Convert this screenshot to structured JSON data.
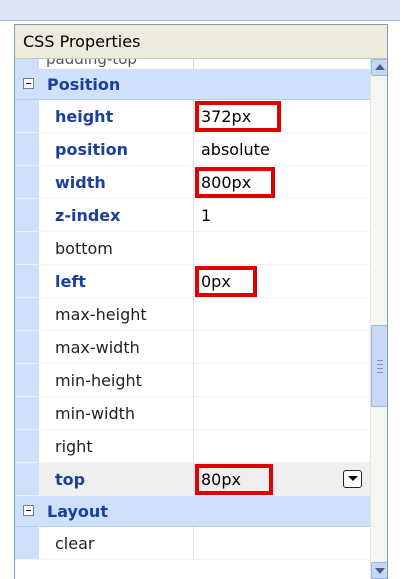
{
  "panel": {
    "title": "CSS Properties"
  },
  "partial_row": {
    "name": "padding-top"
  },
  "categories": [
    {
      "label": "Position"
    },
    {
      "label": "Layout"
    }
  ],
  "position_rows": [
    {
      "name": "height",
      "value": "372px",
      "bold": true,
      "highlighted": true
    },
    {
      "name": "position",
      "value": "absolute",
      "bold": true,
      "highlighted": false
    },
    {
      "name": "width",
      "value": "800px",
      "bold": true,
      "highlighted": true
    },
    {
      "name": "z-index",
      "value": "1",
      "bold": true,
      "highlighted": false
    },
    {
      "name": "bottom",
      "value": "",
      "bold": false,
      "highlighted": false
    },
    {
      "name": "left",
      "value": "0px",
      "bold": true,
      "highlighted": true
    },
    {
      "name": "max-height",
      "value": "",
      "bold": false,
      "highlighted": false
    },
    {
      "name": "max-width",
      "value": "",
      "bold": false,
      "highlighted": false
    },
    {
      "name": "min-height",
      "value": "",
      "bold": false,
      "highlighted": false
    },
    {
      "name": "min-width",
      "value": "",
      "bold": false,
      "highlighted": false
    },
    {
      "name": "right",
      "value": "",
      "bold": false,
      "highlighted": false
    },
    {
      "name": "top",
      "value": "80px",
      "bold": true,
      "highlighted": true,
      "has_dropdown": true
    }
  ],
  "layout_rows": [
    {
      "name": "clear",
      "value": "",
      "bold": false
    }
  ],
  "colors": {
    "highlight": "#e00000",
    "category_bg": "#cfe0fa",
    "bold_name": "#1a3f9c"
  }
}
